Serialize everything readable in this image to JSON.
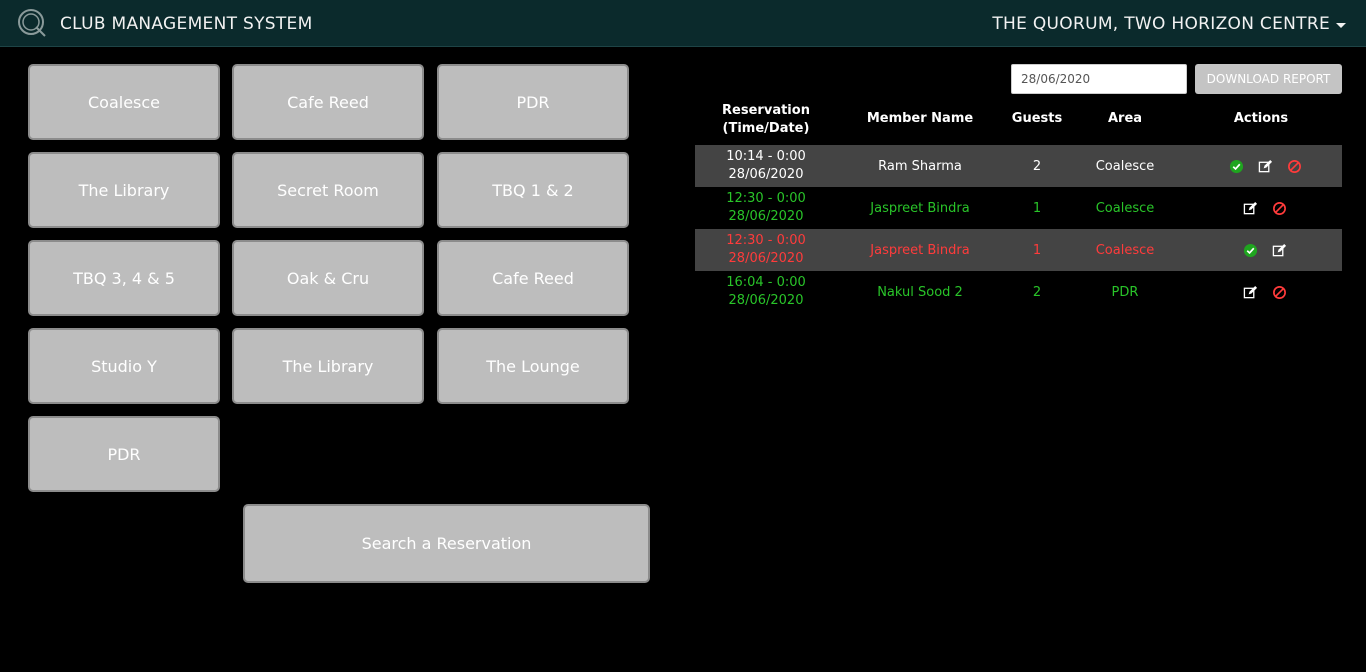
{
  "header": {
    "title": "CLUB MANAGEMENT SYSTEM",
    "venue": "THE QUORUM, TWO HORIZON CENTRE"
  },
  "areas": [
    "Coalesce",
    "Cafe Reed",
    "PDR",
    "The Library",
    "Secret Room",
    "TBQ 1 & 2",
    "TBQ 3, 4 & 5",
    "Oak & Cru",
    "Cafe Reed",
    "Studio Y",
    "The Library",
    "The Lounge",
    "PDR"
  ],
  "search_button": "Search a Reservation",
  "report": {
    "date_value": "28/06/2020",
    "download_label": "DOWNLOAD REPORT"
  },
  "table": {
    "headers": {
      "reservation_line1": "Reservation",
      "reservation_line2": "(Time/Date)",
      "member": "Member Name",
      "guests": "Guests",
      "area": "Area",
      "actions": "Actions"
    },
    "rows": [
      {
        "time": "10:14 - 0:00",
        "date": "28/06/2020",
        "member": "Ram Sharma",
        "guests": "2",
        "area": "Coalesce",
        "status_color": "#ffffff"
      },
      {
        "time": "12:30 - 0:00",
        "date": "28/06/2020",
        "member": "Jaspreet Bindra",
        "guests": "1",
        "area": "Coalesce",
        "status_color": "#29c429"
      },
      {
        "time": "12:30 - 0:00",
        "date": "28/06/2020",
        "member": "Jaspreet Bindra",
        "guests": "1",
        "area": "Coalesce",
        "status_color": "#ff3b3b"
      },
      {
        "time": "16:04 - 0:00",
        "date": "28/06/2020",
        "member": "Nakul Sood 2",
        "guests": "2",
        "area": "PDR",
        "status_color": "#29c429"
      }
    ]
  },
  "icons": {
    "logo": "quorum-q-logo",
    "caret": "chevron-down-icon",
    "approve": "check-circle-icon",
    "edit": "edit-icon",
    "cancel": "ban-icon"
  },
  "colors": {
    "header_bg": "#0b2a2c",
    "tile_bg": "#bdbdbd",
    "row_dark": "#444444",
    "green": "#29c429",
    "red": "#ff3b3b"
  }
}
